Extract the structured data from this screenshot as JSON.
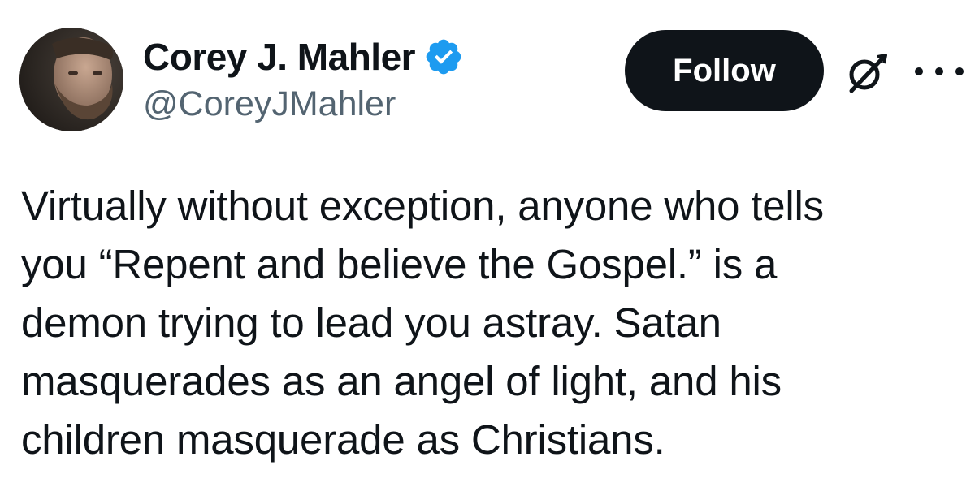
{
  "author": {
    "display_name": "Corey J. Mahler",
    "handle": "@CoreyJMahler",
    "verified_icon": "verified-badge-icon",
    "avatar": "avatar-photo"
  },
  "actions": {
    "follow_label": "Follow",
    "grok_icon": "grok-icon",
    "more_icon": "more-options-icon"
  },
  "tweet": {
    "text": "Virtually without exception, anyone who tells\nyou “Repent and believe the Gospel.” is a\ndemon trying to lead you astray. Satan\nmasquerades as an angel of light, and his\nchildren masquerade as Christians."
  },
  "colors": {
    "text_primary": "#0f1419",
    "text_secondary": "#536471",
    "verified_blue": "#1d9bf0",
    "button_bg": "#0f1419",
    "button_text": "#ffffff"
  }
}
